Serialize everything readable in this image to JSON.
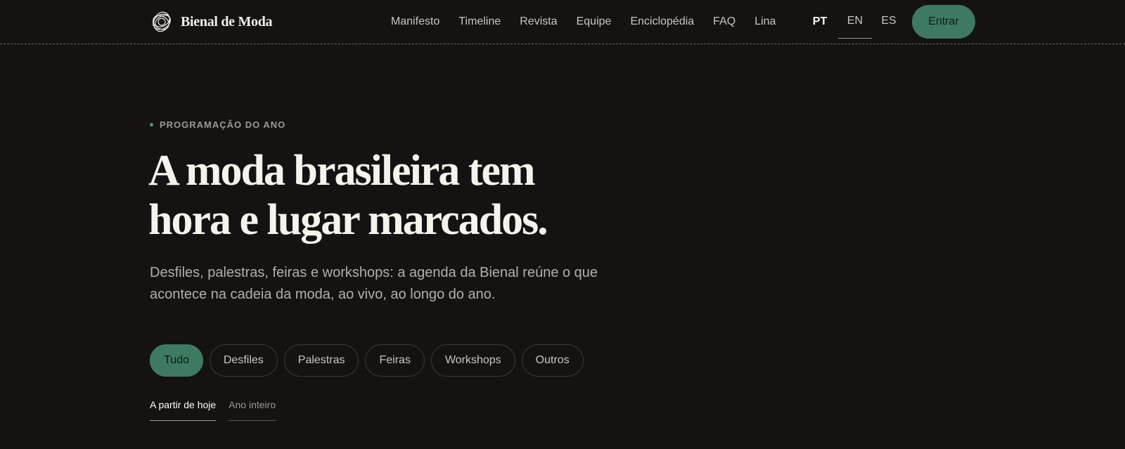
{
  "brand": {
    "name": "Bienal de Moda",
    "icon": "scribble-logo-icon"
  },
  "nav": {
    "items": [
      "Manifesto",
      "Timeline",
      "Revista",
      "Equipe",
      "Enciclopédia",
      "FAQ",
      "Lina"
    ],
    "languages": [
      "PT",
      "EN",
      "ES"
    ],
    "active_language": "PT",
    "cta": "Entrar"
  },
  "hero": {
    "eyebrow": "PROGRAMAÇÃO DO ANO",
    "title_line1": "A moda brasileira tem",
    "title_line2": "hora e lugar marcados.",
    "description": "Desfiles, palestras, feiras e workshops: a agenda da Bienal reúne o que acontece na cadeia da moda, ao vivo, ao longo do ano."
  },
  "filters": {
    "items": [
      "Tudo",
      "Desfiles",
      "Palestras",
      "Feiras",
      "Workshops",
      "Outros"
    ],
    "active": "Tudo"
  },
  "range_tabs": {
    "items": [
      "A partir de hoje",
      "Ano inteiro"
    ],
    "active": "A partir de hoje"
  },
  "colors": {
    "background": "#141312",
    "accent": "#3e7a62",
    "text": "#f6f3ec",
    "muted": "#9c998f"
  }
}
